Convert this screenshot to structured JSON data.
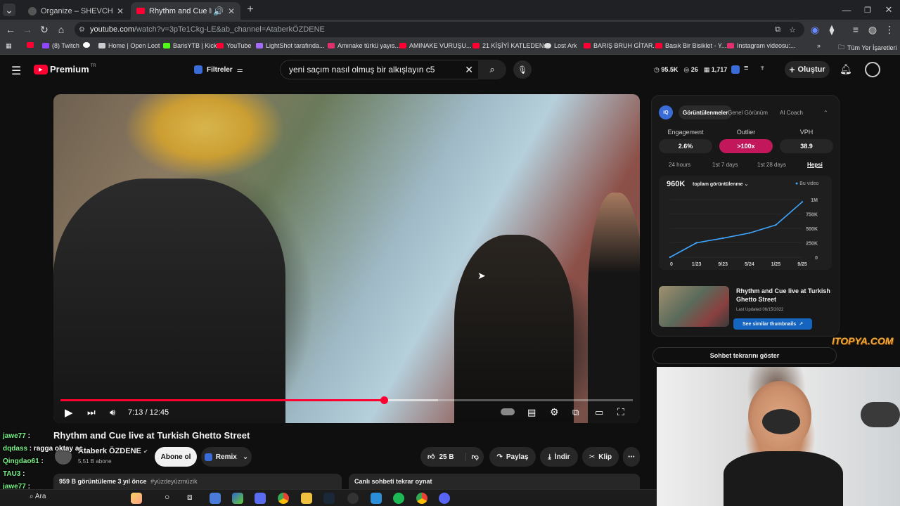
{
  "browser": {
    "tabs": [
      {
        "title": "Organize – SHEVCHENKO Lyrics",
        "active": false
      },
      {
        "title": "Rhythm and Cue live at Turki",
        "active": true
      }
    ],
    "url_host": "youtube.com",
    "url_path": "/watch?v=3pTe1Ckg-LE&ab_channel=AtaberkÖZDENE",
    "bookmarks": [
      "(8) Twitch",
      "Home | Open Loot",
      "BarisYTB | Kick",
      "YouTube",
      "LightShot tarafında...",
      "Amınake türkü yayıs...",
      "AMINAKE VURUŞU...",
      "21 KİŞİYİ KATLEDEN...",
      "Lost Ark",
      "BARIŞ BRUH GİTAR...",
      "Basık Bir Bisiklet - Y...",
      "Instagram videosu:..."
    ],
    "all_bookmarks": "Tüm Yer İşaretleri"
  },
  "youtube": {
    "logo": "Premium",
    "logo_region": "TR",
    "filters_label": "Filtreler",
    "search_value": "yeni saçım nasıl olmuş bir alkışlayın c5",
    "stats": {
      "views": "95.5K",
      "likes": "26",
      "comments": "1,717"
    },
    "create_label": "Oluştur"
  },
  "player": {
    "time": "7:13 / 12:45",
    "progress_percent": 56.5,
    "buffer_percent": 66
  },
  "video": {
    "title": "Rhythm and Cue live at Turkish Ghetto Street",
    "channel": "Ataberk ÖZDENE",
    "subs": "5,51 B abone",
    "subscribe": "Abone ol",
    "remix": "Remix",
    "likes": "25 B",
    "share": "Paylaş",
    "download": "İndir",
    "clip": "Klip",
    "meta": "959 B görüntüleme  3 yıl önce",
    "hashtag": "#yüzdeyüzmüzik",
    "chat_replay": "Canlı sohbeti tekrar oynat",
    "show_chat": "Sohbet tekrarını göster"
  },
  "iq": {
    "tabs": [
      "Görüntülenmeler",
      "Genel Görünüm",
      "AI Coach"
    ],
    "metrics": [
      {
        "label": "Engagement",
        "value": "2.6%",
        "highlight": false
      },
      {
        "label": "Outlier",
        "value": ">100x",
        "highlight": true
      },
      {
        "label": "VPH",
        "value": "38.9",
        "highlight": false
      }
    ],
    "ranges": [
      "24 hours",
      "1st 7 days",
      "1st 28 days",
      "Hepsi"
    ],
    "total": "960K",
    "total_label": "toplam görüntülenme",
    "legend": "Bu video",
    "similar": {
      "title": "Rhythm and Cue live at Turkish Ghetto Street",
      "updated": "Last Updated 06/15/2022",
      "button": "See similar thumbnails"
    }
  },
  "chart_data": {
    "type": "line",
    "x": [
      "0",
      "1/23",
      "9/23",
      "5/24",
      "1/25",
      "9/25"
    ],
    "series": [
      {
        "values": [
          0,
          250,
          330,
          420,
          560,
          960
        ]
      }
    ],
    "yticks": [
      "0",
      "250K",
      "500K",
      "750K",
      "1M"
    ],
    "ylim": [
      0,
      1000
    ],
    "color": "#3ea6ff"
  },
  "chat": [
    {
      "user": "jawe77",
      "msg": ""
    },
    {
      "user": "dqdass",
      "msg": "ragga oktay aç"
    },
    {
      "user": "Qingdao61",
      "msg": ""
    },
    {
      "user": "TAU3",
      "msg": ""
    },
    {
      "user": "jawe77",
      "msg": ""
    },
    {
      "user": "jawe77",
      "msg": ""
    }
  ],
  "overlay_logo": "ITOPYA.COM",
  "taskbar": {
    "search": "Ara"
  }
}
